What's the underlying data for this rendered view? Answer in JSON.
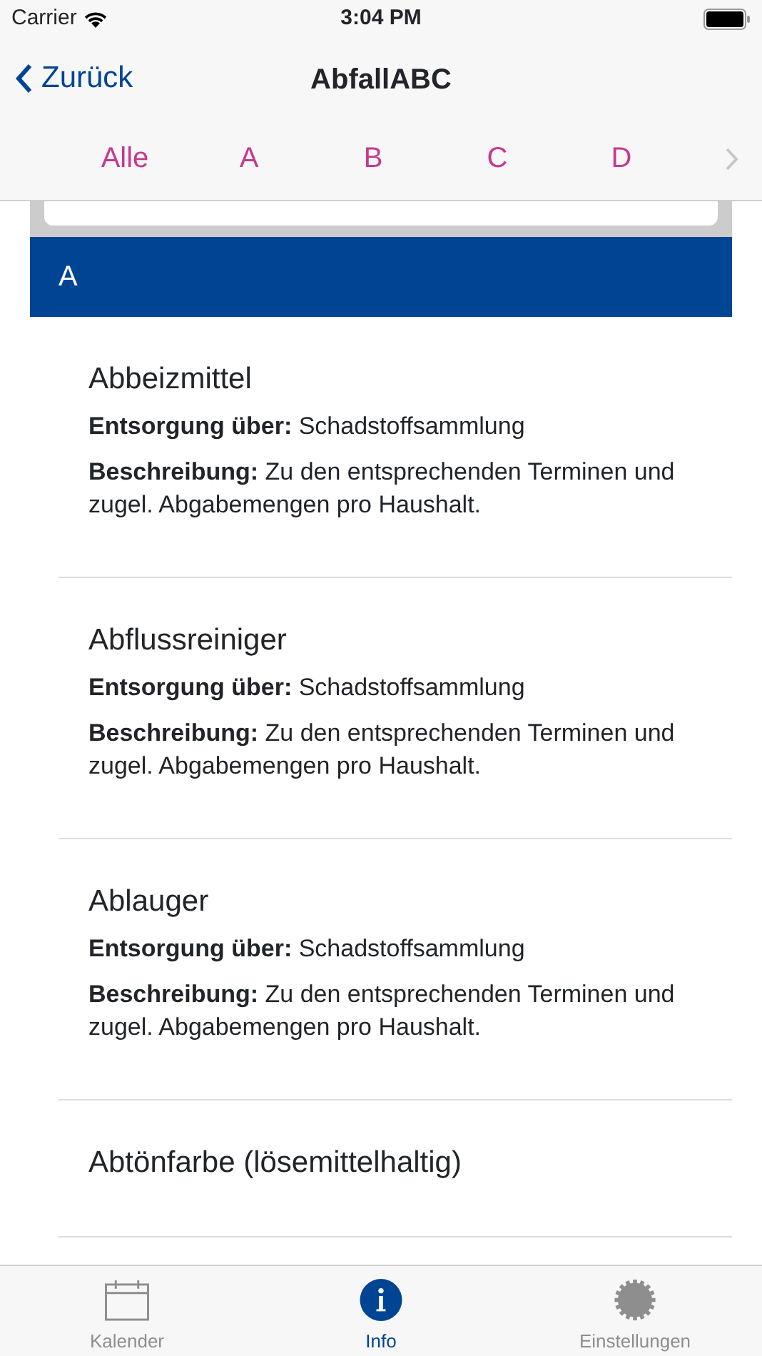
{
  "status_bar": {
    "carrier": "Carrier",
    "time": "3:04 PM"
  },
  "nav": {
    "back": "Zurück",
    "title": "AbfallABC"
  },
  "letters": [
    "Alle",
    "A",
    "B",
    "C",
    "D"
  ],
  "section": {
    "header": "A"
  },
  "entries": [
    {
      "name": "Abbeizmittel",
      "disposal_label": "Entsorgung über:",
      "disposal": "Schadstoffsammlung",
      "description_label": "Beschreibung:",
      "description": "Zu den entsprechenden Terminen und zugel. Abgabemengen pro Haushalt."
    },
    {
      "name": "Abflussreiniger",
      "disposal_label": "Entsorgung über:",
      "disposal": "Schadstoffsammlung",
      "description_label": "Beschreibung:",
      "description": "Zu den entsprechenden Terminen und zugel. Abgabemengen pro Haushalt."
    },
    {
      "name": "Ablauger",
      "disposal_label": "Entsorgung über:",
      "disposal": "Schadstoffsammlung",
      "description_label": "Beschreibung:",
      "description": "Zu den entsprechenden Terminen und zugel. Abgabemengen pro Haushalt."
    },
    {
      "name": "Abtönfarbe (lösemittelhaltig)"
    }
  ],
  "tab_bar": [
    {
      "label": "Kalender",
      "kind": "calendar",
      "selected": false
    },
    {
      "label": "Info",
      "kind": "info",
      "selected": true
    },
    {
      "label": "Einstellungen",
      "kind": "settings",
      "selected": false
    }
  ]
}
